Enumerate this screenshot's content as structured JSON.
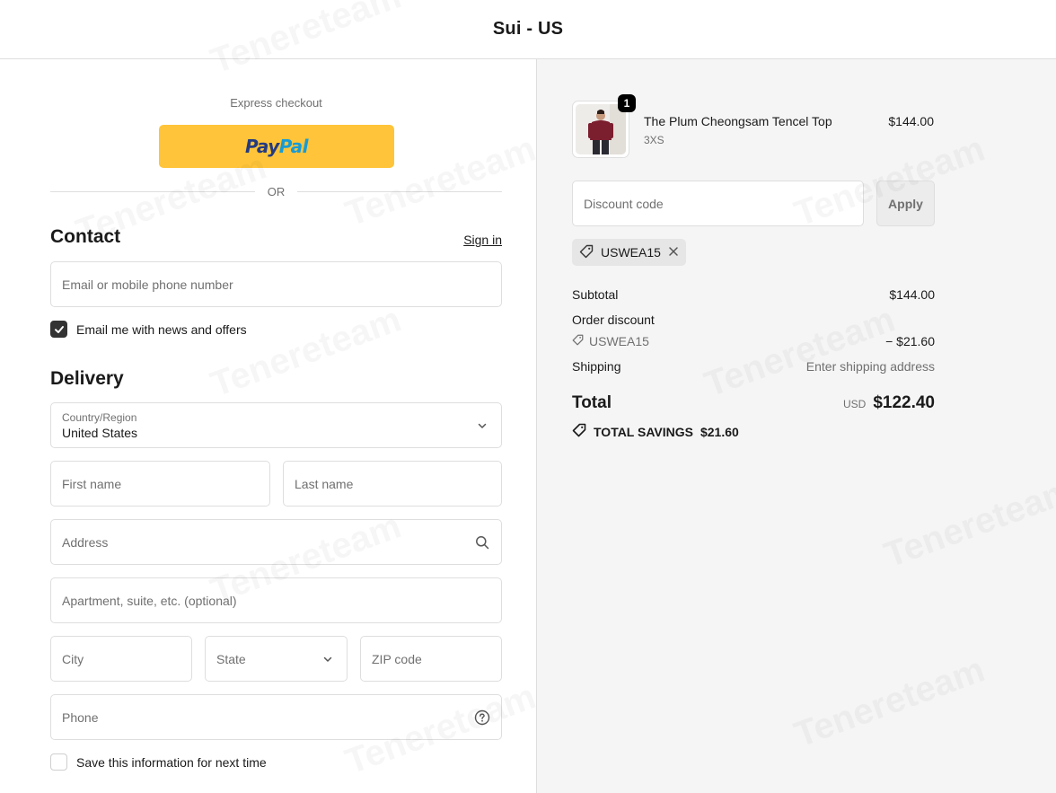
{
  "header": {
    "store_title": "Sui - US"
  },
  "express": {
    "label": "Express checkout",
    "paypal_a": "Pay",
    "paypal_b": "Pal",
    "or": "OR"
  },
  "contact": {
    "title": "Contact",
    "signin": "Sign in",
    "email_placeholder": "Email or mobile phone number",
    "newsletter_label": "Email me with news and offers",
    "newsletter_checked": true
  },
  "delivery": {
    "title": "Delivery",
    "country_label": "Country/Region",
    "country_value": "United States",
    "first_name": "First name",
    "last_name": "Last name",
    "address": "Address",
    "apartment": "Apartment, suite, etc. (optional)",
    "city": "City",
    "state": "State",
    "zip": "ZIP code",
    "phone": "Phone",
    "save_label": "Save this information for next time",
    "save_checked": false
  },
  "cart": {
    "item": {
      "quantity": "1",
      "name": "The Plum Cheongsam Tencel Top",
      "variant": "3XS",
      "price": "$144.00"
    },
    "discount_placeholder": "Discount code",
    "apply": "Apply",
    "applied_code": "USWEA15"
  },
  "summary": {
    "subtotal_label": "Subtotal",
    "subtotal_value": "$144.00",
    "order_discount_label": "Order discount",
    "discount_code": "USWEA15",
    "discount_value": "− $21.60",
    "shipping_label": "Shipping",
    "shipping_value": "Enter shipping address",
    "total_label": "Total",
    "total_currency": "USD",
    "total_value": "$122.40",
    "savings_label": "TOTAL SAVINGS",
    "savings_value": "$21.60"
  },
  "watermark": "Tenereteam"
}
